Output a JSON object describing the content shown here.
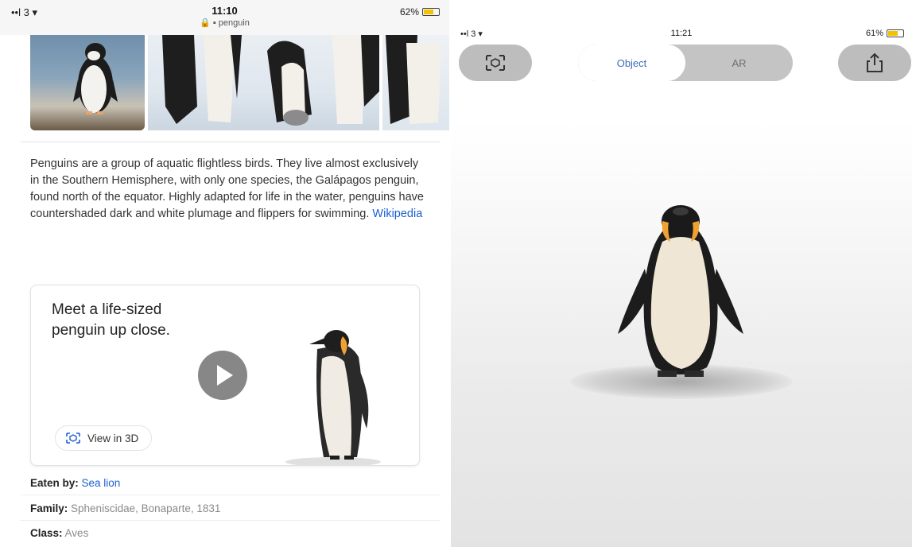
{
  "left": {
    "status": {
      "signal": "••l 3 ▾",
      "time": "11:10",
      "url": "🔒 ▪ penguin",
      "battery": "62%",
      "battery_level": 0.62
    },
    "description": {
      "text": "Penguins are a group of aquatic flightless birds. They live almost exclusively in the Southern Hemisphere, with only one species, the Galápagos penguin, found north of the equator. Highly adapted for life in the water, penguins have countershaded dark and white plumage and flippers for swimming.",
      "source_link": "Wikipedia"
    },
    "card": {
      "title": "Meet a life-sized penguin up close.",
      "view_button": "View in 3D"
    },
    "facts": [
      {
        "label": "Eaten by:",
        "value": "Sea lion"
      },
      {
        "label": "Family:",
        "value": "Spheniscidae, Bonaparte, 1831"
      },
      {
        "label": "Class:",
        "value": "Aves"
      }
    ]
  },
  "right": {
    "status": {
      "signal": "••l 3 ▾",
      "time": "11:21",
      "battery": "61%",
      "battery_level": 0.61
    },
    "tabs": {
      "object": "Object",
      "ar": "AR"
    },
    "icons": {
      "mode": "ar-mode-icon",
      "share": "share-icon"
    }
  },
  "colors": {
    "link": "#1a5fd1",
    "selected_tab_text": "#3b6fb8",
    "battery": "#f3c200",
    "button_gray": "#bdbdbd"
  }
}
